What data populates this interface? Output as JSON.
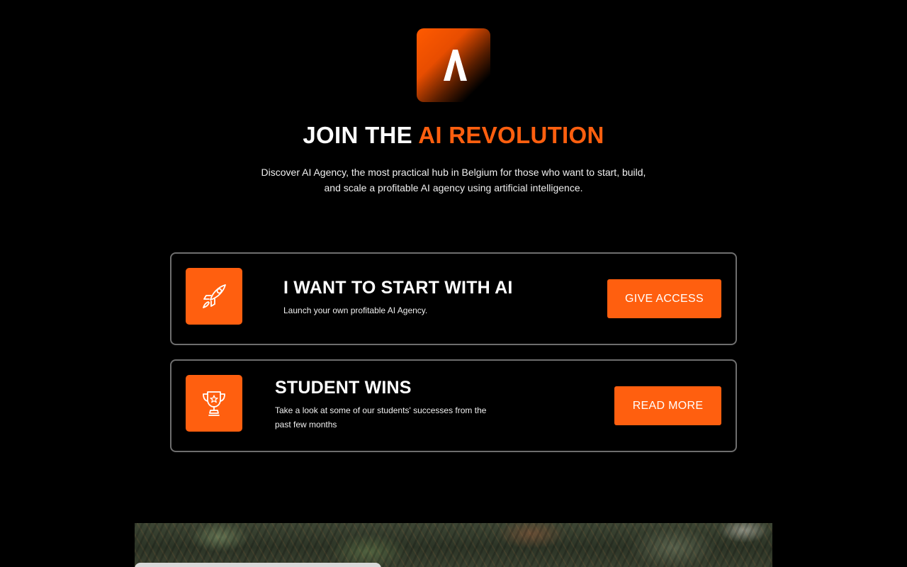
{
  "brand": {
    "logo_icon": "a-letter-logo-icon",
    "accent_color": "#ff5f0f"
  },
  "hero": {
    "title_prefix": "JOIN THE",
    "title_accent": "AI REVOLUTION",
    "subtitle": "Discover AI Agency, the most practical hub in Belgium for those who want to start, build, and scale a profitable AI agency using artificial intelligence."
  },
  "cards": [
    {
      "icon": "rocket-icon",
      "title": "I WANT TO START WITH AI",
      "description": "Launch your own profitable AI Agency.",
      "button_label": "GIVE ACCESS"
    },
    {
      "icon": "trophy-icon",
      "title": "STUDENT WINS",
      "description": "Take a look at some of our students' successes from the past few months",
      "button_label": "READ MORE"
    }
  ]
}
